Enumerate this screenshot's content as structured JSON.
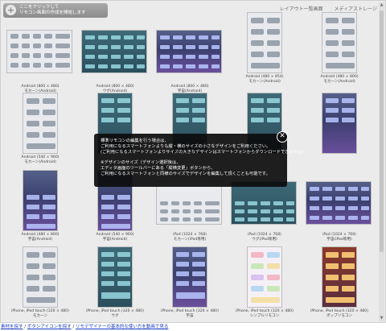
{
  "header": {
    "new_button_line1": "ここをクリックして",
    "new_button_line2": "リモコン画面の作成を開始します",
    "tabs": [
      "レイアウト一覧画面",
      "メディアストレージ"
    ]
  },
  "grid": [
    [
      "Android (800 × 480)",
      "モカーン(Android)"
    ],
    [
      "Android (800 × 480)",
      "ウグ(Android)"
    ],
    [
      "Android (800 × 480)",
      "宇宙(Android)"
    ],
    [
      "Android (480 × 854)",
      "モカーン(Android)"
    ],
    [
      "Android (480 × 800)",
      "モカーン(Android)"
    ],
    [
      "Android (540 × 960)",
      "モカーン(Android)"
    ],
    [
      "",
      ""
    ],
    [
      "",
      ""
    ],
    [
      "",
      ""
    ],
    [
      "",
      ""
    ],
    [
      "Android (480 × 800)",
      "宇宙(Android)"
    ],
    [
      "Android (540 × 960)",
      "宇宙(Android)"
    ],
    [
      "iPad (1024 × 768)",
      "モカーン(iPad専用)"
    ],
    [
      "iPad (1024 × 768)",
      "ウグ(iPad専用)"
    ],
    [
      "iPad (1024 × 768)",
      "宇宙(iPad専用)"
    ],
    [
      "iPhone, iPod touch (320 × 480)",
      "モカーン"
    ],
    [
      "iPhone, iPod touch (320 × 480)",
      "ウグ"
    ],
    [
      "iPhone, iPod touch (320 × 480)",
      "宇宙"
    ],
    [
      "iPhone, iPod touch (320 × 480)",
      "シンプルリモコン"
    ],
    [
      "iPhone, iPod touch (320 × 480)",
      "ポップリモコン"
    ]
  ],
  "overlay": {
    "line1": "標準リモコンの編集を行う場合は、",
    "line2": "ご利用になるスマートフォンよりも縦・横のサイズの小さなデザインをご利用ください。",
    "line3": "(ご利用になるスマートフォンよりサイズの大きなデザインはスマートフォンからダウンロードできません)",
    "line4": "※デザインのサイズ（デザイン選択後は、",
    "line5": "エディタ画面のツールバーにある「縦横変更」ボタンから、",
    "line6": "ご利用になるスマートフォンと同様のサイズでデザインを編集して頂くことも可能です。",
    "close_glyph": "✕"
  },
  "footer": {
    "link1": "素材を探す",
    "sep1": " / ",
    "link2": "ボタンアイコンを探す",
    "sep2": " / ",
    "link3": "リモデザイナーの基本的な使い方を動画で見る"
  },
  "scrollbar": {
    "up": "▲",
    "down": "▼"
  }
}
